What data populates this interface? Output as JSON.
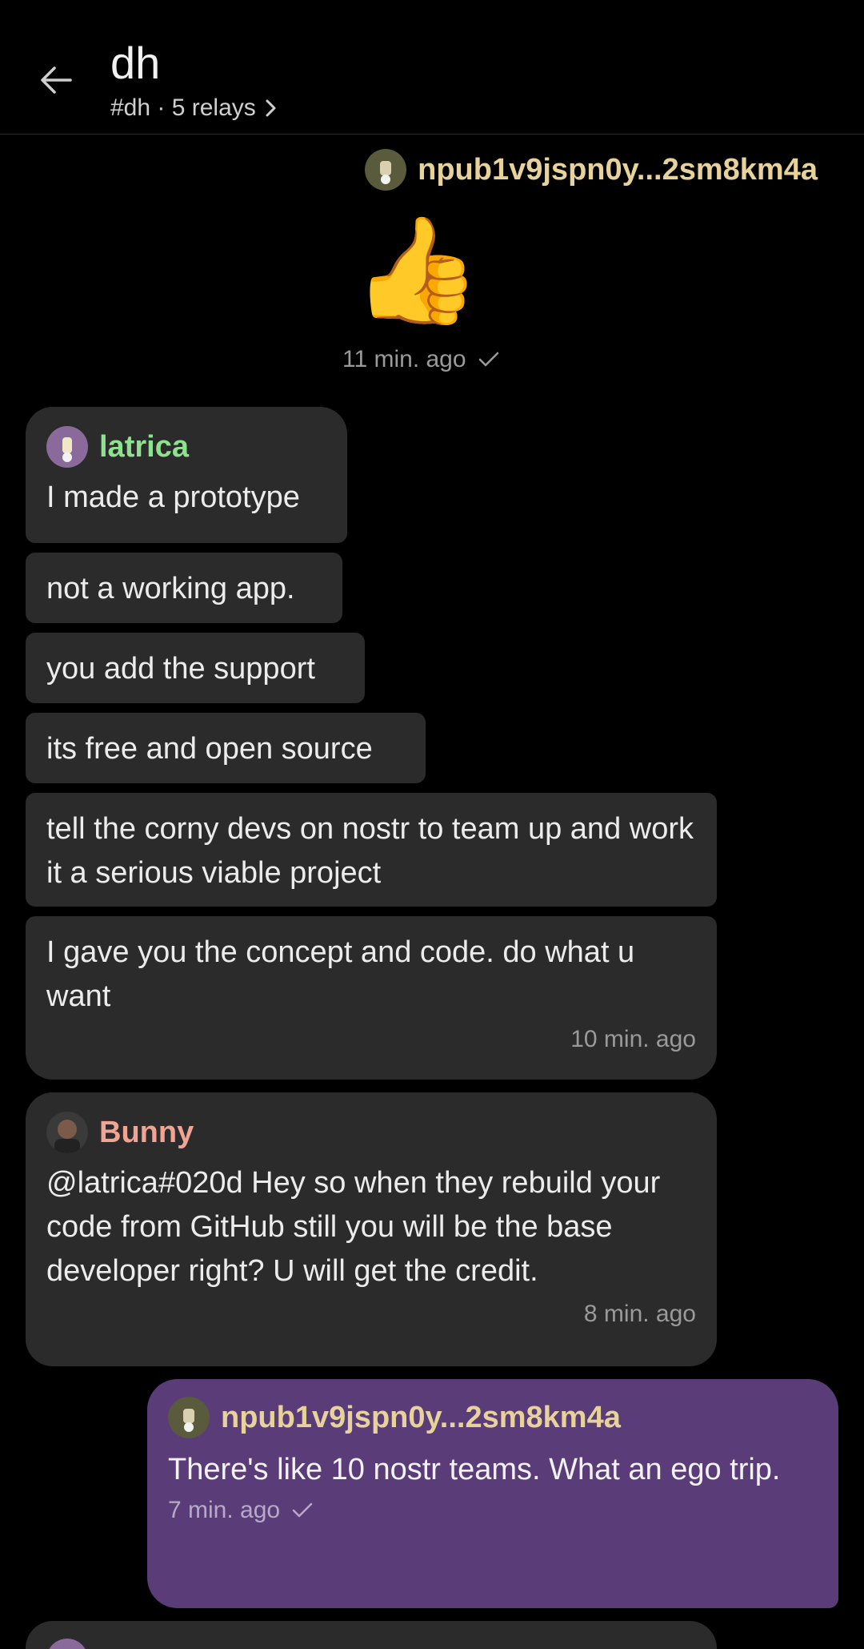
{
  "header": {
    "title": "dh",
    "subtitle": "#dh · 5 relays"
  },
  "messages": {
    "npub_display": "npub1v9jspn0y...2sm8km4a",
    "first": {
      "emoji": "👍",
      "time": "11 min. ago"
    },
    "latrica": {
      "author": "latrica",
      "lines": [
        "I made a prototype",
        "not a working app.",
        "you add the support",
        "its free and open source",
        "tell the corny devs on nostr to team up and work it a serious viable project",
        "I gave you the concept and code. do what u want"
      ],
      "time": "10 min. ago"
    },
    "bunny": {
      "author": "Bunny",
      "text": "@latrica#020d Hey so when they rebuild your code from GitHub still you will be the base developer right? U will get the credit.",
      "time": "8 min. ago"
    },
    "mine": {
      "text": "There's like 10 nostr teams. What an ego trip.",
      "time": "7 min. ago"
    }
  },
  "colors": {
    "background": "#000000",
    "bubble": "#2b2b2b",
    "own_bubble": "#5a3d78",
    "npub_name": "#e6d29a",
    "latrica_name": "#8fe08f",
    "bunny_name": "#f0a494"
  }
}
